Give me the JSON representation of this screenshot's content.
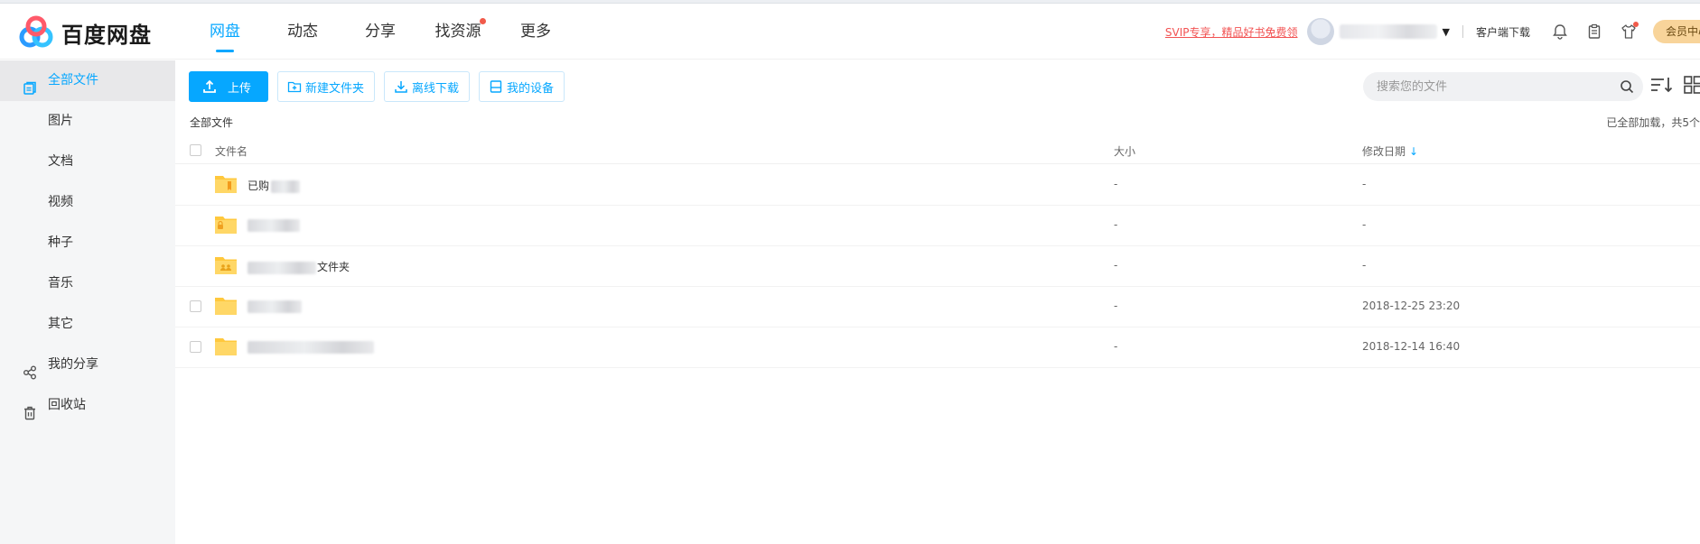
{
  "header": {
    "logo_text": "百度网盘",
    "nav": [
      {
        "label": "网盘",
        "active": true
      },
      {
        "label": "动态",
        "active": false
      },
      {
        "label": "分享",
        "active": false
      },
      {
        "label": "找资源",
        "active": false,
        "dot": true
      },
      {
        "label": "更多",
        "active": false
      }
    ],
    "svip_promo": "SVIP专享，精品好书免费领",
    "client_download": "客户端下载",
    "member_label": "会员中心"
  },
  "sidebar": {
    "items": [
      {
        "label": "全部文件",
        "active": true
      },
      {
        "label": "图片"
      },
      {
        "label": "文档"
      },
      {
        "label": "视频"
      },
      {
        "label": "种子"
      },
      {
        "label": "音乐"
      },
      {
        "label": "其它"
      },
      {
        "label": "我的分享"
      },
      {
        "label": "回收站"
      }
    ]
  },
  "toolbar": {
    "upload": "上传",
    "new_folder": "新建文件夹",
    "offline_download": "离线下载",
    "my_devices": "我的设备"
  },
  "search": {
    "placeholder": "搜索您的文件"
  },
  "breadcrumb": "全部文件",
  "load_status": "已全部加载，共5个",
  "table": {
    "headers": {
      "name": "文件名",
      "size": "大小",
      "date": "修改日期",
      "sort_arrow": "↓"
    },
    "rows": [
      {
        "name_visible": "已购",
        "name_suffix": "",
        "size": "-",
        "date": "-"
      },
      {
        "name_visible": "",
        "name_suffix": "",
        "size": "-",
        "date": "-"
      },
      {
        "name_visible": "",
        "name_suffix": "文件夹",
        "size": "-",
        "date": "-"
      },
      {
        "name_visible": "",
        "name_suffix": "",
        "size": "-",
        "date": "2018-12-25 23:20"
      },
      {
        "name_visible": "",
        "name_suffix": "",
        "size": "-",
        "date": "2018-12-14 16:40"
      }
    ]
  },
  "colors": {
    "accent": "#06a7ff",
    "promo_red": "#f25252",
    "folder_yellow": "#ffc83d"
  }
}
